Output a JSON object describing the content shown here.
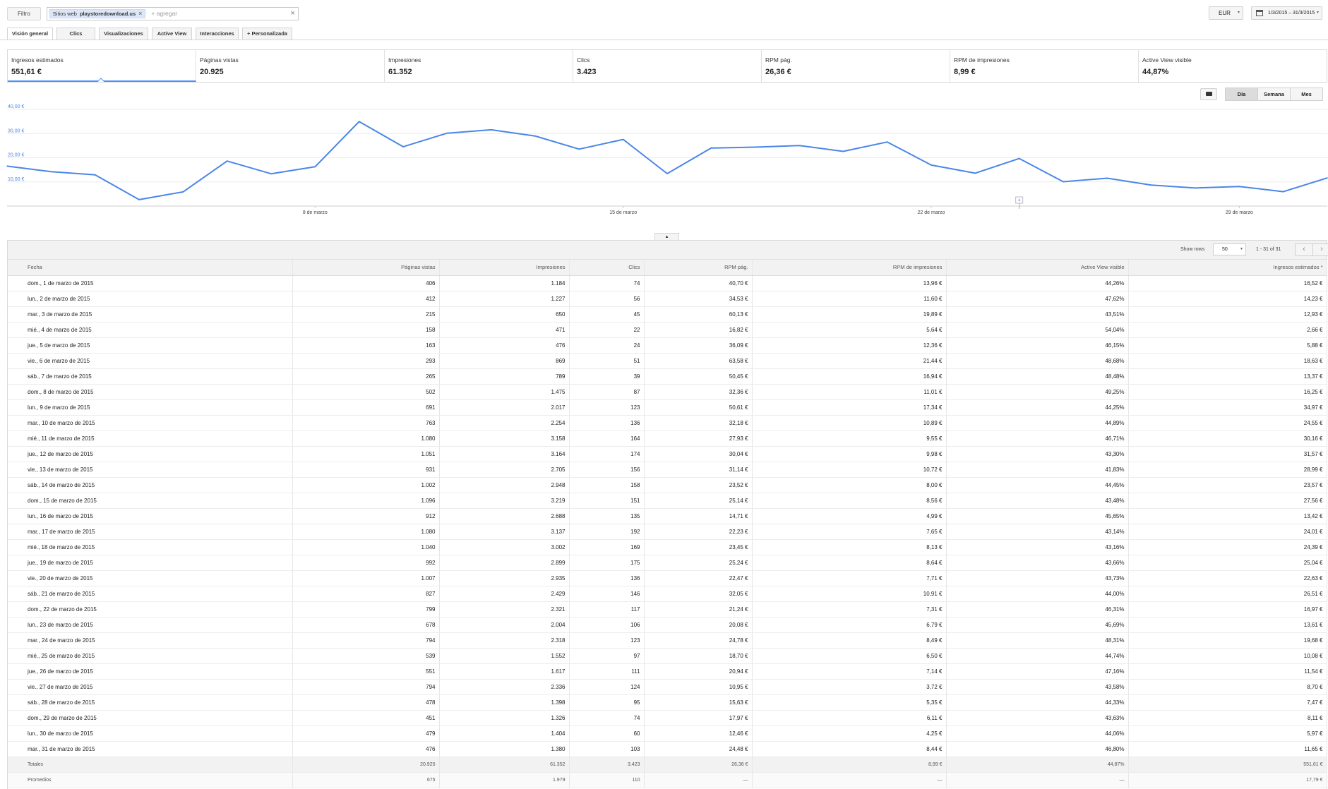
{
  "filter": {
    "button_label": "Filtro",
    "chip_prefix": "Sitios web",
    "chip_value": "playstoredownload.us",
    "chip_remove": "×",
    "add_placeholder": "+ agregar",
    "clear": "×"
  },
  "currency": {
    "value": "EUR",
    "caret": "▾"
  },
  "date_range": {
    "value": "1/3/2015 – 31/3/2015",
    "caret": "▾"
  },
  "tabs": [
    {
      "label": "Visión general"
    },
    {
      "label": "Clics"
    },
    {
      "label": "Visualizaciones"
    },
    {
      "label": "Active View"
    },
    {
      "label": "Interacciones"
    },
    {
      "label": "+ Personalizada"
    }
  ],
  "metrics": [
    {
      "label": "Ingresos estimados",
      "value": "551,61 €"
    },
    {
      "label": "Páginas vistas",
      "value": "20.925"
    },
    {
      "label": "Impresiones",
      "value": "61.352"
    },
    {
      "label": "Clics",
      "value": "3.423"
    },
    {
      "label": "RPM pág.",
      "value": "26,36 €"
    },
    {
      "label": "RPM de impresiones",
      "value": "8,99 €"
    },
    {
      "label": "Active View visible",
      "value": "44,87%"
    }
  ],
  "granularity": {
    "day": "Día",
    "week": "Semana",
    "month": "Mes"
  },
  "chart_data": {
    "type": "line",
    "series": [
      {
        "name": "Ingresos estimados",
        "values": [
          16.52,
          14.23,
          12.93,
          2.66,
          5.88,
          18.63,
          13.37,
          16.25,
          34.97,
          24.55,
          30.16,
          31.57,
          28.99,
          23.57,
          27.56,
          13.42,
          24.01,
          24.39,
          25.04,
          22.63,
          26.51,
          16.97,
          13.61,
          19.68,
          10.08,
          11.54,
          8.7,
          7.47,
          8.11,
          5.97,
          11.65
        ]
      }
    ],
    "x": [
      "1 mar",
      "2 mar",
      "3 mar",
      "4 mar",
      "5 mar",
      "6 mar",
      "7 mar",
      "8 mar",
      "9 mar",
      "10 mar",
      "11 mar",
      "12 mar",
      "13 mar",
      "14 mar",
      "15 mar",
      "16 mar",
      "17 mar",
      "18 mar",
      "19 mar",
      "20 mar",
      "21 mar",
      "22 mar",
      "23 mar",
      "24 mar",
      "25 mar",
      "26 mar",
      "27 mar",
      "28 mar",
      "29 mar",
      "30 mar",
      "31 mar"
    ],
    "x_tick_labels": [
      {
        "index": 7,
        "label": "8 de marzo"
      },
      {
        "index": 14,
        "label": "15 de marzo"
      },
      {
        "index": 21,
        "label": "22 de marzo"
      },
      {
        "index": 28,
        "label": "29 de marzo"
      }
    ],
    "y_ticks": [
      {
        "value": 10,
        "label": "10,00 €"
      },
      {
        "value": 20,
        "label": "20,00 €"
      },
      {
        "value": 30,
        "label": "30,00 €"
      },
      {
        "value": 40,
        "label": "40,00 €"
      }
    ],
    "ylim": [
      0,
      40
    ],
    "grid": true,
    "color": "#4a86e8",
    "annotation_marker": {
      "index": 23,
      "label": "+"
    }
  },
  "table": {
    "show_rows_label": "Show rows",
    "rows_value": "50",
    "range_label": "1 - 31 of 31",
    "prev": "‹",
    "next": "›",
    "headers": [
      "Fecha",
      "Páginas vistas",
      "Impresiones",
      "Clics",
      "RPM pág.",
      "RPM de impresiones",
      "Active View visible",
      "Ingresos estimados *"
    ],
    "rows": [
      [
        "dom., 1 de marzo de 2015",
        "406",
        "1.184",
        "74",
        "40,70 €",
        "13,96 €",
        "44,26%",
        "16,52 €"
      ],
      [
        "lun., 2 de marzo de 2015",
        "412",
        "1.227",
        "56",
        "34,53 €",
        "11,60 €",
        "47,62%",
        "14,23 €"
      ],
      [
        "mar., 3 de marzo de 2015",
        "215",
        "650",
        "45",
        "60,13 €",
        "19,89 €",
        "43,51%",
        "12,93 €"
      ],
      [
        "mié., 4 de marzo de 2015",
        "158",
        "471",
        "22",
        "16,82 €",
        "5,64 €",
        "54,04%",
        "2,66 €"
      ],
      [
        "jue., 5 de marzo de 2015",
        "163",
        "476",
        "24",
        "36,09 €",
        "12,36 €",
        "46,15%",
        "5,88 €"
      ],
      [
        "vie., 6 de marzo de 2015",
        "293",
        "869",
        "51",
        "63,58 €",
        "21,44 €",
        "48,68%",
        "18,63 €"
      ],
      [
        "sáb., 7 de marzo de 2015",
        "265",
        "789",
        "39",
        "50,45 €",
        "16,94 €",
        "48,48%",
        "13,37 €"
      ],
      [
        "dom., 8 de marzo de 2015",
        "502",
        "1.475",
        "87",
        "32,36 €",
        "11,01 €",
        "49,25%",
        "16,25 €"
      ],
      [
        "lun., 9 de marzo de 2015",
        "691",
        "2.017",
        "123",
        "50,61 €",
        "17,34 €",
        "44,25%",
        "34,97 €"
      ],
      [
        "mar., 10 de marzo de 2015",
        "763",
        "2.254",
        "136",
        "32,18 €",
        "10,89 €",
        "44,89%",
        "24,55 €"
      ],
      [
        "mié., 11 de marzo de 2015",
        "1.080",
        "3.158",
        "164",
        "27,93 €",
        "9,55 €",
        "46,71%",
        "30,16 €"
      ],
      [
        "jue., 12 de marzo de 2015",
        "1.051",
        "3.164",
        "174",
        "30,04 €",
        "9,98 €",
        "43,30%",
        "31,57 €"
      ],
      [
        "vie., 13 de marzo de 2015",
        "931",
        "2.705",
        "156",
        "31,14 €",
        "10,72 €",
        "41,83%",
        "28,99 €"
      ],
      [
        "sáb., 14 de marzo de 2015",
        "1.002",
        "2.948",
        "158",
        "23,52 €",
        "8,00 €",
        "44,45%",
        "23,57 €"
      ],
      [
        "dom., 15 de marzo de 2015",
        "1.096",
        "3.219",
        "151",
        "25,14 €",
        "8,56 €",
        "43,48%",
        "27,56 €"
      ],
      [
        "lun., 16 de marzo de 2015",
        "912",
        "2.688",
        "135",
        "14,71 €",
        "4,99 €",
        "45,65%",
        "13,42 €"
      ],
      [
        "mar., 17 de marzo de 2015",
        "1.080",
        "3.137",
        "192",
        "22,23 €",
        "7,65 €",
        "43,14%",
        "24,01 €"
      ],
      [
        "mié., 18 de marzo de 2015",
        "1.040",
        "3.002",
        "169",
        "23,45 €",
        "8,13 €",
        "43,16%",
        "24,39 €"
      ],
      [
        "jue., 19 de marzo de 2015",
        "992",
        "2.899",
        "175",
        "25,24 €",
        "8,64 €",
        "43,66%",
        "25,04 €"
      ],
      [
        "vie., 20 de marzo de 2015",
        "1.007",
        "2.935",
        "136",
        "22,47 €",
        "7,71 €",
        "43,73%",
        "22,63 €"
      ],
      [
        "sáb., 21 de marzo de 2015",
        "827",
        "2.429",
        "146",
        "32,05 €",
        "10,91 €",
        "44,00%",
        "26,51 €"
      ],
      [
        "dom., 22 de marzo de 2015",
        "799",
        "2.321",
        "117",
        "21,24 €",
        "7,31 €",
        "46,31%",
        "16,97 €"
      ],
      [
        "lun., 23 de marzo de 2015",
        "678",
        "2.004",
        "106",
        "20,08 €",
        "6,79 €",
        "45,69%",
        "13,61 €"
      ],
      [
        "mar., 24 de marzo de 2015",
        "794",
        "2.318",
        "123",
        "24,78 €",
        "8,49 €",
        "48,31%",
        "19,68 €"
      ],
      [
        "mié., 25 de marzo de 2015",
        "539",
        "1.552",
        "97",
        "18,70 €",
        "6,50 €",
        "44,74%",
        "10,08 €"
      ],
      [
        "jue., 26 de marzo de 2015",
        "551",
        "1.617",
        "111",
        "20,94 €",
        "7,14 €",
        "47,16%",
        "11,54 €"
      ],
      [
        "vie., 27 de marzo de 2015",
        "794",
        "2.336",
        "124",
        "10,95 €",
        "3,72 €",
        "43,58%",
        "8,70 €"
      ],
      [
        "sáb., 28 de marzo de 2015",
        "478",
        "1.398",
        "95",
        "15,63 €",
        "5,35 €",
        "44,33%",
        "7,47 €"
      ],
      [
        "dom., 29 de marzo de 2015",
        "451",
        "1.326",
        "74",
        "17,97 €",
        "6,11 €",
        "43,63%",
        "8,11 €"
      ],
      [
        "lun., 30 de marzo de 2015",
        "479",
        "1.404",
        "60",
        "12,46 €",
        "4,25 €",
        "44,06%",
        "5,97 €"
      ],
      [
        "mar., 31 de marzo de 2015",
        "476",
        "1.380",
        "103",
        "24,48 €",
        "8,44 €",
        "46,80%",
        "11,65 €"
      ]
    ],
    "totals": [
      "Totales",
      "20.925",
      "61.352",
      "3.423",
      "26,36 €",
      "8,99 €",
      "44,87%",
      "551,61 €"
    ],
    "averages": [
      "Promedios",
      "675",
      "1.979",
      "110",
      "—",
      "—",
      "—",
      "17,79 €"
    ]
  }
}
